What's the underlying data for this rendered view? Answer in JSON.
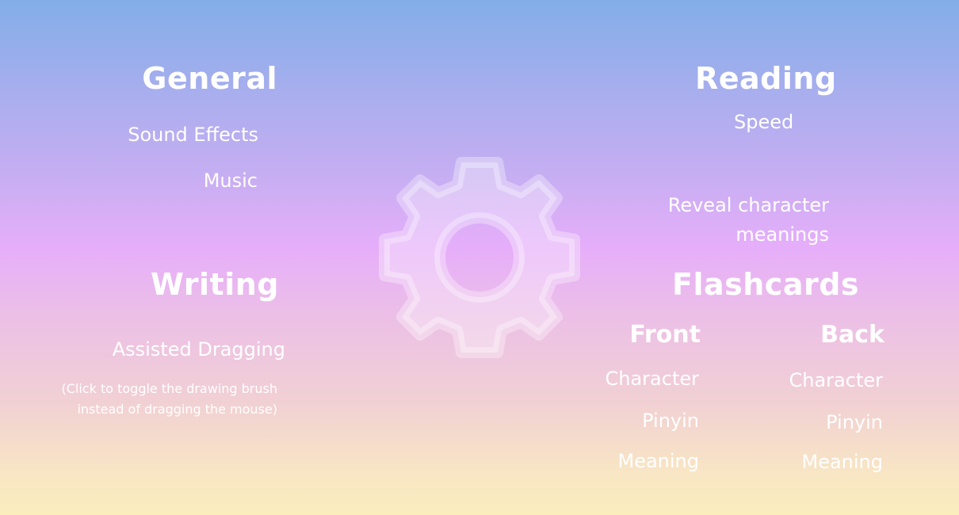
{
  "general": {
    "heading": "General",
    "options": {
      "sound_effects": "Sound Effects",
      "music": "Music"
    }
  },
  "reading": {
    "heading": "Reading",
    "options": {
      "speed": "Speed",
      "reveal_line1": "Reveal character",
      "reveal_line2": "meanings"
    }
  },
  "writing": {
    "heading": "Writing",
    "options": {
      "assisted_dragging": "Assisted Dragging",
      "assisted_dragging_note": "(Click to toggle the drawing brush instead of dragging the mouse)"
    }
  },
  "flashcards": {
    "heading": "Flashcards",
    "front": {
      "label": "Front",
      "options": [
        "Character",
        "Pinyin",
        "Meaning"
      ]
    },
    "back": {
      "label": "Back",
      "options": [
        "Character",
        "Pinyin",
        "Meaning"
      ]
    }
  },
  "icons": {
    "center": "gear-icon"
  },
  "colors": {
    "gradient_top": "#82aee8",
    "gradient_middle": "#e6aefa",
    "gradient_bottom": "#fbedbc",
    "text": "#ffffff",
    "gear": "#ffffff"
  }
}
